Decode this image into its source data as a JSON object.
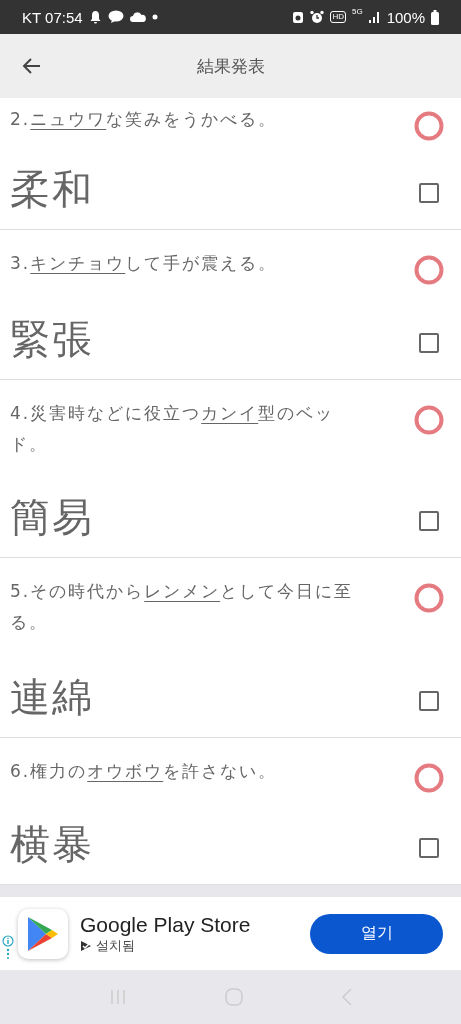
{
  "status_bar": {
    "carrier_time": "KT 07:54",
    "network": "5G",
    "hd": "HD",
    "battery": "100%"
  },
  "header": {
    "title": "結果発表"
  },
  "questions": [
    {
      "number": "2.",
      "underlined": "ニュウワ",
      "after": "な笑みをうかべる。",
      "answer": "柔和",
      "correct": true,
      "checked": false
    },
    {
      "number": "3.",
      "underlined": "キンチョウ",
      "after": "して手が震える。",
      "answer": "緊張",
      "correct": true,
      "checked": false
    },
    {
      "number": "4.",
      "before": "災害時などに役立つ",
      "underlined": "カンイ",
      "after": "型のベッド。",
      "answer": "簡易",
      "correct": true,
      "checked": false
    },
    {
      "number": "5.",
      "before": "その時代から",
      "underlined": "レンメン",
      "after": "として今日に至る。",
      "answer": "連綿",
      "correct": true,
      "checked": false
    },
    {
      "number": "6.",
      "before": "権力の",
      "underlined": "オウボウ",
      "after": "を許さない。",
      "answer": "横暴",
      "correct": true,
      "checked": false
    }
  ],
  "ad": {
    "title": "Google Play Store",
    "status": "설치됨",
    "button": "열기"
  }
}
